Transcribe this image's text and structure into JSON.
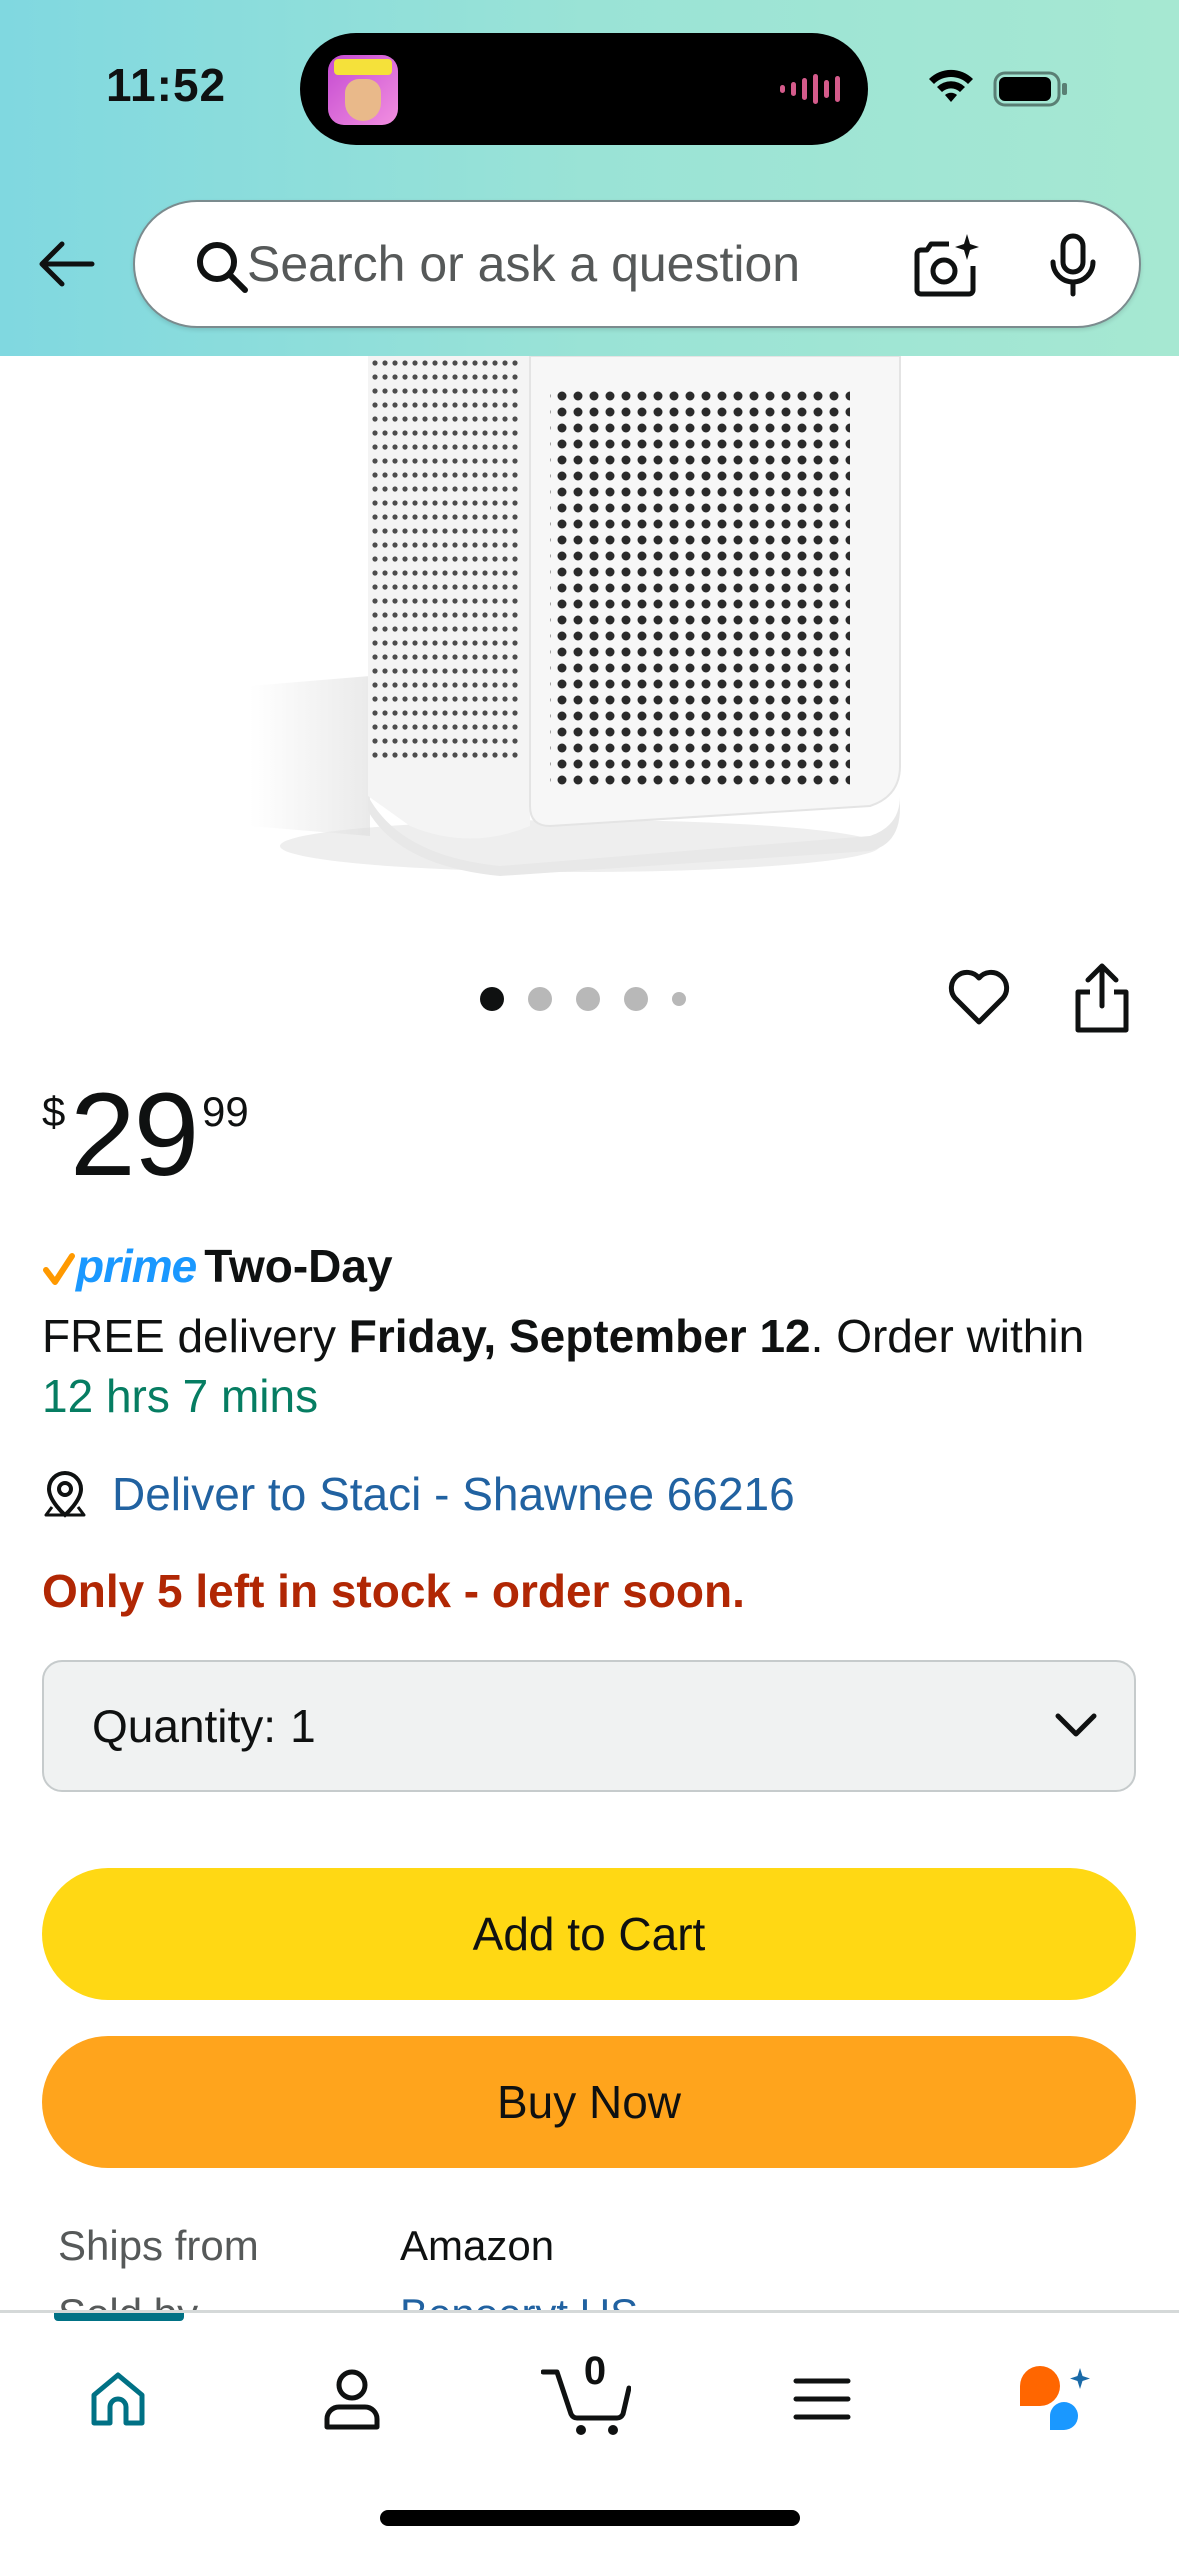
{
  "status_bar": {
    "time": "11:52",
    "wifi_icon": "wifi-icon",
    "battery_icon": "battery-icon"
  },
  "header": {
    "back_icon": "arrow-left-icon",
    "search": {
      "placeholder": "Search or ask a question",
      "camera_icon": "camera-sparkle-icon",
      "mic_icon": "microphone-icon"
    },
    "colors": {
      "gradient_start": "#80d8e0",
      "gradient_end": "#a6e8d2"
    }
  },
  "product": {
    "image_alt": "white air purifier",
    "carousel": {
      "count": 5,
      "active": 1
    },
    "actions": {
      "wishlist_icon": "heart-icon",
      "share_icon": "share-icon"
    }
  },
  "price": {
    "currency": "$",
    "whole": "29",
    "fraction": "99"
  },
  "prime": {
    "brand": "prime",
    "label": "Two-Day",
    "color": "#1a98ff"
  },
  "delivery": {
    "prefix": "FREE delivery ",
    "date": "Friday, September 12",
    "suffix": ". Order within",
    "countdown": "12 hrs 7 mins",
    "deliver_to": "Deliver to Staci - Shawnee 66216"
  },
  "stock": {
    "message": "Only 5 left in stock - order soon.",
    "color": "#b12704"
  },
  "quantity": {
    "label": "Quantity:",
    "value": "1"
  },
  "buttons": {
    "add_to_cart": "Add to Cart",
    "buy_now": "Buy Now",
    "cart_color": "#ffd814",
    "buy_color": "#ffa41c"
  },
  "fulfillment": {
    "ships_from_label": "Ships from",
    "ships_from_value": "Amazon",
    "sold_by_label": "Sold by",
    "sold_by_value": "Benoeryt US"
  },
  "bottom_nav": {
    "items": [
      "home-icon",
      "account-icon",
      "cart-icon",
      "menu-icon",
      "rufus-icon"
    ],
    "cart_count": "0",
    "active_color": "#007185"
  }
}
